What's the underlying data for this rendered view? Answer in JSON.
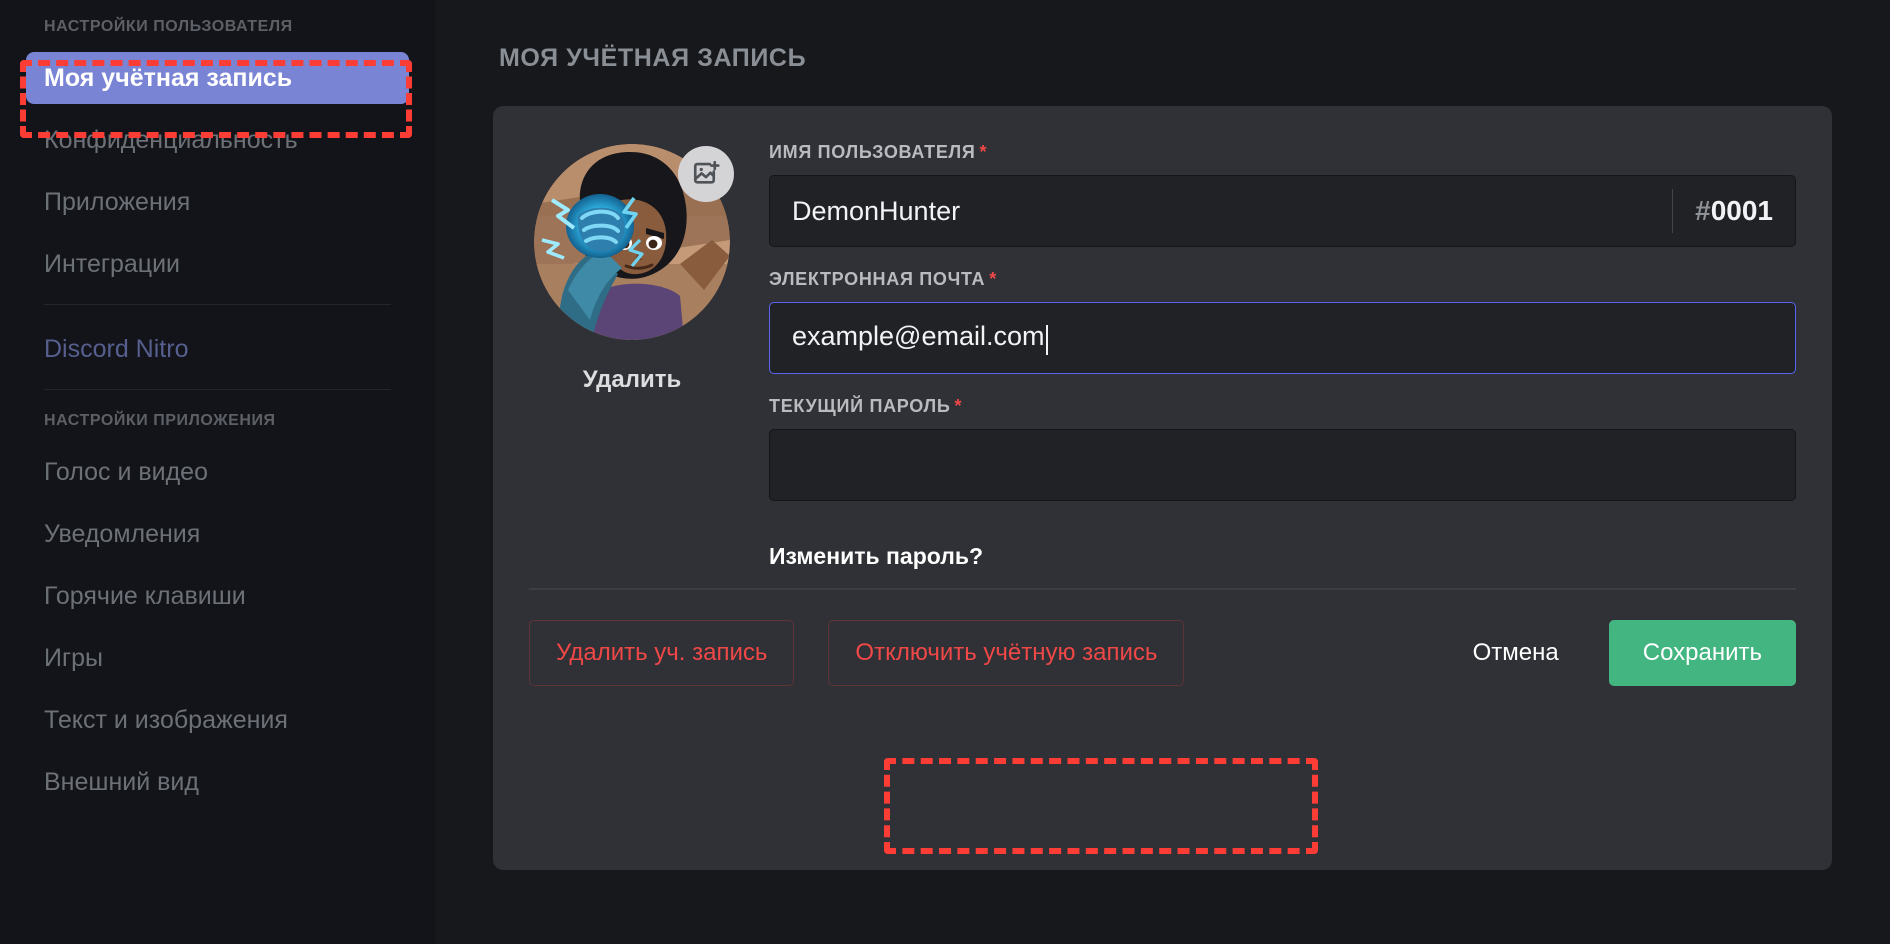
{
  "sidebar": {
    "section_user": "НАСТРОЙКИ ПОЛЬЗОВАТЕЛЯ",
    "section_app": "НАСТРОЙКИ ПРИЛОЖЕНИЯ",
    "user_items": [
      {
        "label": "Моя учётная запись",
        "active": true
      },
      {
        "label": "Конфиденциальность",
        "active": false
      },
      {
        "label": "Приложения",
        "active": false
      },
      {
        "label": "Интеграции",
        "active": false
      }
    ],
    "nitro": {
      "label": "Discord Nitro",
      "color": "#565f8e"
    },
    "app_items": [
      {
        "label": "Голос и видео"
      },
      {
        "label": "Уведомления"
      },
      {
        "label": "Горячие клавиши"
      },
      {
        "label": "Игры"
      },
      {
        "label": "Текст и изображения"
      },
      {
        "label": "Внешний вид"
      }
    ]
  },
  "main": {
    "page_title": "МОЯ УЧЁТНАЯ ЗАПИСЬ",
    "avatar": {
      "remove_label": "Удалить",
      "badge_icon": "add-image-icon"
    },
    "fields": {
      "username": {
        "label": "ИМЯ ПОЛЬЗОВАТЕЛЯ",
        "required_marker": "*",
        "value": "DemonHunter",
        "discriminator_hash": "#",
        "discriminator": "0001",
        "focused": false
      },
      "email": {
        "label": "ЭЛЕКТРОННАЯ ПОЧТА",
        "required_marker": "*",
        "value": "example@email.com",
        "focused": true
      },
      "password": {
        "label": "ТЕКУЩИЙ ПАРОЛЬ",
        "required_marker": "*",
        "value": "",
        "focused": false
      }
    },
    "change_password_link": "Изменить пароль?",
    "buttons": {
      "delete_account": "Удалить уч. запись",
      "disable_account": "Отключить учётную запись",
      "cancel": "Отмена",
      "save": "Сохранить"
    }
  },
  "colors": {
    "accent_blurple": "#7a84d4",
    "focus_border": "#5865f2",
    "danger_red": "#f04747",
    "save_green": "#43b581",
    "annotation_red": "#fc3d36",
    "card_bg": "#2f3136",
    "input_bg": "#202225",
    "sidebar_bg": "#131419",
    "main_bg": "#17181c"
  }
}
